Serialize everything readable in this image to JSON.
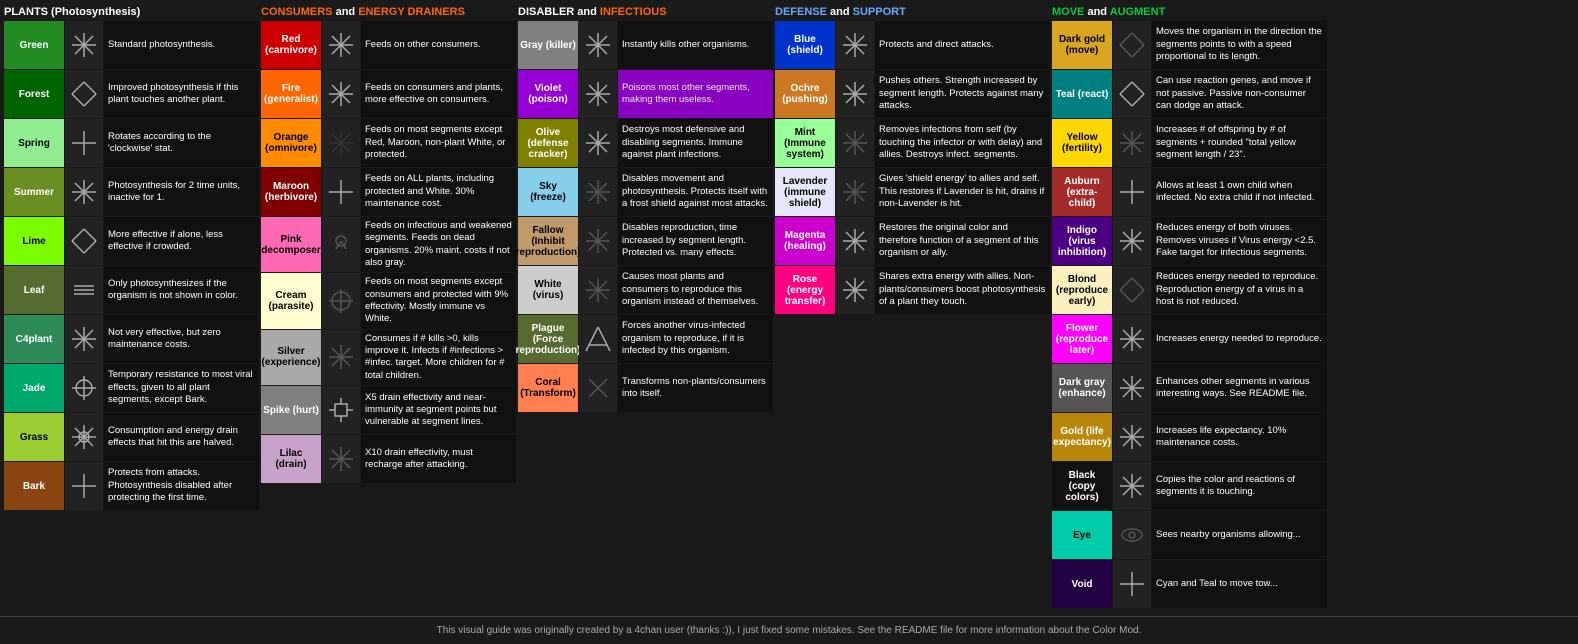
{
  "sections": {
    "plants": {
      "header": "PLANTS (Photosynthesis)",
      "items": [
        {
          "name": "Green",
          "desc": "Standard photosynthesis.",
          "bg": "bg-green"
        },
        {
          "name": "Forest",
          "desc": "Improved photosynthesis if this plant touches another plant.",
          "bg": "bg-forest"
        },
        {
          "name": "Spring",
          "desc": "Rotates according to the 'clockwise' stat.",
          "bg": "bg-spring",
          "labelColor": "#000"
        },
        {
          "name": "Summer",
          "desc": "Photosynthesis for 2 time units, inactive for 1.",
          "bg": "bg-summer"
        },
        {
          "name": "Lime",
          "desc": "More effective if alone, less effective if crowded.",
          "bg": "bg-lime"
        },
        {
          "name": "Leaf",
          "desc": "Only photosynthesizes if the organism is not shown in color.",
          "bg": "bg-leaf"
        },
        {
          "name": "C4plant",
          "desc": "Not very effective, but zero maintenance costs.",
          "bg": "bg-c4plant"
        },
        {
          "name": "Jade",
          "desc": "Temporary resistance to most viral effects, given to all plant segments, except Bark.",
          "bg": "bg-jade"
        },
        {
          "name": "Grass",
          "desc": "Consumption and energy drain effects that hit this are halved.",
          "bg": "bg-grass"
        },
        {
          "name": "Bark",
          "desc": "Protects from attacks. Photosynthesis disabled after protecting the first time.",
          "bg": "bg-bark"
        }
      ]
    },
    "consumers": {
      "header_plain": "CONSUMERS",
      "header_and": " and ",
      "header_highlight": "ENERGY DRAINERS",
      "items": [
        {
          "name": "Red (carnivore)",
          "desc": "Feeds on other consumers.",
          "bg": "bg-red"
        },
        {
          "name": "Fire (generalist)",
          "desc": "Feeds on consumers and plants, more effective on consumers.",
          "bg": "bg-fire"
        },
        {
          "name": "Orange (omnivore)",
          "desc": "Feeds on most segments except Red, Maroon, non-plant White, or protected.",
          "bg": "bg-orange"
        },
        {
          "name": "Maroon (herbivore)",
          "desc": "Feeds on ALL plants, including protected and White. 30% maintenance cost.",
          "bg": "bg-maroon"
        },
        {
          "name": "Pink (decomposer)",
          "desc": "Feeds on infectious and weakened segments. Feeds on dead organisms. 20% maint. costs if not also gray.",
          "bg": "bg-pink"
        },
        {
          "name": "Cream (parasite)",
          "desc": "Feeds on most segments except consumers and protected with 9% effectivity. Mostly immune vs White.",
          "bg": "bg-cream"
        },
        {
          "name": "Silver (experience)",
          "desc": "Consumes if # kills >0, kills improve it. Infects if #infections > #infec. target. More children for # total children.",
          "bg": "bg-silver"
        },
        {
          "name": "Spike (hurt)",
          "desc": "X5 drain effectivity and near-immunity at segment points but vulnerable at segment lines.",
          "bg": "bg-spike"
        },
        {
          "name": "Lilac (drain)",
          "desc": "X10 drain effectivity, must recharge after attacking.",
          "bg": "bg-lilac"
        }
      ]
    },
    "disabler": {
      "header_plain": "DISABLER",
      "header_and": " and ",
      "header_highlight": "INFECTIOUS",
      "items": [
        {
          "name": "Gray (killer)",
          "desc": "Instantly kills other organisms.",
          "bg": "bg-gray"
        },
        {
          "name": "Violet (poison)",
          "desc": "Poisons most other segments, making them useless.",
          "bg": "bg-violet"
        },
        {
          "name": "Olive (defense cracker)",
          "desc": "Destroys most defensive and disabling segments. Immune against plant infections.",
          "bg": "bg-olive"
        },
        {
          "name": "Sky (freeze)",
          "desc": "Disables movement and photosynthesis. Protects itself with a frost shield against most attacks.",
          "bg": "bg-sky"
        },
        {
          "name": "Fallow (Inhibit reproduction)",
          "desc": "Disables reproduction, time increased by segment length. Protected vs. many effects.",
          "bg": "bg-fallow"
        },
        {
          "name": "White (virus)",
          "desc": "Causes most plants and consumers to reproduce this organism instead of themselves.",
          "bg": "bg-white"
        },
        {
          "name": "Plague (Force reproduction)",
          "desc": "Forces another virus-infected organism to reproduce, if it is infected by this organism.",
          "bg": "bg-plague"
        },
        {
          "name": "Coral (Transform)",
          "desc": "Transforms non-plants/consumers into itself.",
          "bg": "bg-coral"
        }
      ]
    },
    "defense": {
      "header_plain": "DEFENSE",
      "header_and": " and ",
      "header_highlight": "SUPPORT",
      "items": [
        {
          "name": "Blue (shield)",
          "desc": "Protects and direct attacks.",
          "bg": "bg-blue"
        },
        {
          "name": "Ochre (pushing)",
          "desc": "Pushes others. Strength increased by segment length. Protects against many attacks.",
          "bg": "bg-ochre"
        },
        {
          "name": "Mint (Immune system)",
          "desc": "Removes infections from self (by touching the infector or with delay) and allies. Destroys infect. segments.",
          "bg": "bg-mint"
        },
        {
          "name": "Lavender (immune shield)",
          "desc": "Gives 'shield energy' to allies and self. This restores if Lavender is hit, drains if non-Lavender is hit.",
          "bg": "bg-lavender"
        },
        {
          "name": "Magenta (healing)",
          "desc": "Restores the original color and therefore function of a segment of this organism or ally.",
          "bg": "bg-magenta"
        },
        {
          "name": "Rose (energy transfer)",
          "desc": "Shares extra energy with allies. Non-plants/consumers boost photosynthesis of a plant they touch.",
          "bg": "bg-rose"
        }
      ]
    },
    "move": {
      "header_plain": "MOVE",
      "header_and": " and ",
      "header_highlight": "AUGMENT",
      "items": [
        {
          "name": "Dark gold (move)",
          "desc": "Moves the organism in the direction the segments points to with a speed proportional to its length.",
          "bg": "bg-dark-gold"
        },
        {
          "name": "Teal (react)",
          "desc": "Can use reaction genes, and move if not passive. Passive non-consumer can dodge an attack.",
          "bg": "bg-teal"
        },
        {
          "name": "Yellow (fertility)",
          "desc": "Increases # of offspring by # of segments + rounded 'total yellow segment length / 23'.",
          "bg": "bg-yellow"
        },
        {
          "name": "Auburn (extra-child)",
          "desc": "Allows at least 1 own child when infected. No extra child if not infected.",
          "bg": "bg-auburn"
        },
        {
          "name": "Indigo (virus inhibition)",
          "desc": "Reduces energy of both viruses. Removes viruses if Virus energy <2.5. Fake target for infectious segments.",
          "bg": "bg-indigo"
        },
        {
          "name": "Blond (reproduce early)",
          "desc": "Reduces energy needed to reproduce. Reproduction energy of a virus in a host is not reduced.",
          "bg": "bg-blond"
        },
        {
          "name": "Flower (reproduce later)",
          "desc": "Increases energy needed to reproduce.",
          "bg": "bg-flower"
        },
        {
          "name": "Dark gray (enhance)",
          "desc": "Enhances other segments in various interesting ways. See README file.",
          "bg": "bg-dark-gray"
        },
        {
          "name": "Gold (life expectancy)",
          "desc": "Increases life expectancy. 10% maintenance costs.",
          "bg": "bg-gold"
        },
        {
          "name": "Black (copy colors)",
          "desc": "Copies the color and reactions of segments it is touching.",
          "bg": "bg-black"
        },
        {
          "name": "Eye",
          "desc": "Sees nearby organisms allowing...",
          "bg": "bg-eye"
        },
        {
          "name": "Void",
          "desc": "Cyan and Teal to move tow...",
          "bg": "bg-void"
        }
      ]
    }
  },
  "footer": "This visual guide was originally created by a 4chan user (thanks :)), I just fixed some mistakes. See the README file for more information about the Color Mod."
}
